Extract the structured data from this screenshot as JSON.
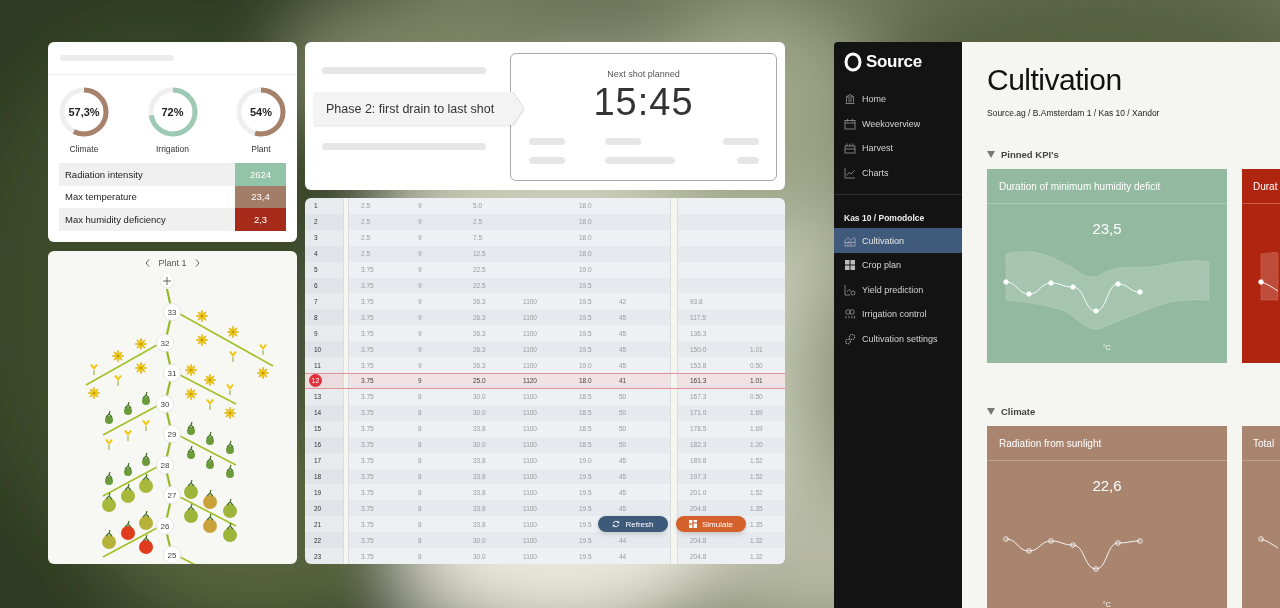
{
  "summary": {
    "donuts": [
      {
        "value": "57,3%",
        "label": "Climate",
        "level": 0.573,
        "color": "#a7816a"
      },
      {
        "value": "72%",
        "label": "Irrigation",
        "level": 0.72,
        "color": "#9dcab4"
      },
      {
        "value": "54%",
        "label": "Plant",
        "level": 0.54,
        "color": "#a7816a"
      }
    ],
    "kpis": [
      {
        "label": "Radiation intensity",
        "value": "2624",
        "color": "#93c3a9"
      },
      {
        "label": "Max temperature",
        "value": "23,4",
        "color": "#a47d69"
      },
      {
        "label": "Max humidity deficiency",
        "value": "2,3",
        "color": "#a52a1a"
      }
    ]
  },
  "plant": {
    "title": "Plant 1",
    "nodes": [
      "33",
      "32",
      "31",
      "30",
      "29",
      "28",
      "27",
      "26",
      "25"
    ]
  },
  "shot": {
    "phase": "Phase 2: first drain to last shot",
    "next_label": "Next shot planned",
    "time": "15:45"
  },
  "schedule": {
    "rows": [
      {
        "index": "1",
        "cells": [
          "2.5",
          "9",
          "5.0",
          null,
          "18.0",
          null,
          null,
          null
        ],
        "selected": false
      },
      {
        "index": "2",
        "cells": [
          "2.5",
          "9",
          "2.5",
          null,
          "18.0",
          null,
          null,
          null
        ],
        "selected": false
      },
      {
        "index": "3",
        "cells": [
          "2.5",
          "9",
          "7.5",
          null,
          "18.0",
          null,
          null,
          null
        ],
        "selected": false
      },
      {
        "index": "4",
        "cells": [
          "2.5",
          "9",
          "12.5",
          null,
          "18.0",
          null,
          null,
          null
        ],
        "selected": false
      },
      {
        "index": "5",
        "cells": [
          "3.75",
          "9",
          "22.5",
          null,
          "19.0",
          null,
          null,
          null
        ],
        "selected": false
      },
      {
        "index": "6",
        "cells": [
          "3.75",
          "9",
          "22.5",
          null,
          "19.5",
          null,
          null,
          null
        ],
        "selected": false
      },
      {
        "index": "7",
        "cells": [
          "3.75",
          "9",
          "26.3",
          "1100",
          "19.5",
          "42",
          "93.8",
          null
        ],
        "selected": false
      },
      {
        "index": "8",
        "cells": [
          "3.75",
          "9",
          "26.3",
          "1100",
          "19.5",
          "45",
          "117.5",
          null
        ],
        "selected": false
      },
      {
        "index": "9",
        "cells": [
          "3.75",
          "9",
          "26.3",
          "1100",
          "19.5",
          "45",
          "136.3",
          null
        ],
        "selected": false
      },
      {
        "index": "10",
        "cells": [
          "3.75",
          "9",
          "26.3",
          "1100",
          "19.5",
          "45",
          "150.0",
          "1.01"
        ],
        "selected": false
      },
      {
        "index": "11",
        "cells": [
          "3.75",
          "9",
          "26.3",
          "1100",
          "19.0",
          "45",
          "153.8",
          "0.50"
        ],
        "selected": false
      },
      {
        "index": "12",
        "cells": [
          "3.75",
          "9",
          "25.0",
          "1120",
          "18.0",
          "41",
          "161.3",
          "1.01"
        ],
        "selected": true
      },
      {
        "index": "13",
        "cells": [
          "3.75",
          "8",
          "30.0",
          "1100",
          "18.5",
          "50",
          "167.3",
          "0.50"
        ],
        "selected": false
      },
      {
        "index": "14",
        "cells": [
          "3.75",
          "8",
          "30.0",
          "1100",
          "18.5",
          "50",
          "171.0",
          "1.69"
        ],
        "selected": false
      },
      {
        "index": "15",
        "cells": [
          "3.75",
          "8",
          "33.8",
          "1100",
          "18.5",
          "50",
          "178.5",
          "1.69"
        ],
        "selected": false
      },
      {
        "index": "16",
        "cells": [
          "3.75",
          "8",
          "30.0",
          "1100",
          "18.5",
          "50",
          "182.3",
          "1.20"
        ],
        "selected": false
      },
      {
        "index": "17",
        "cells": [
          "3.75",
          "8",
          "33.8",
          "1100",
          "19.0",
          "45",
          "189.8",
          "1.52"
        ],
        "selected": false
      },
      {
        "index": "18",
        "cells": [
          "3.75",
          "8",
          "33.8",
          "1100",
          "19.5",
          "45",
          "197.3",
          "1.52"
        ],
        "selected": false
      },
      {
        "index": "19",
        "cells": [
          "3.75",
          "8",
          "33.8",
          "1100",
          "19.5",
          "45",
          "201.0",
          "1.52"
        ],
        "selected": false
      },
      {
        "index": "20",
        "cells": [
          "3.75",
          "8",
          "33.8",
          "1100",
          "19.5",
          "45",
          "204.8",
          "1.35"
        ],
        "selected": false
      },
      {
        "index": "21",
        "cells": [
          "3.75",
          "8",
          "33.8",
          "1100",
          "19.5",
          null,
          null,
          "1.35"
        ],
        "selected": false
      },
      {
        "index": "22",
        "cells": [
          "3.75",
          "8",
          "30.0",
          "1100",
          "19.5",
          "44",
          "204.8",
          "1.32"
        ],
        "selected": false
      },
      {
        "index": "23",
        "cells": [
          "3.75",
          "8",
          "30.0",
          "1100",
          "19.5",
          "44",
          "204.8",
          "1.32"
        ],
        "selected": false
      }
    ],
    "actions": [
      {
        "label": "Refresh",
        "kind": "refresh"
      },
      {
        "label": "Simulate",
        "kind": "simulate"
      }
    ]
  },
  "app": {
    "logo": "Source",
    "nav": [
      {
        "label": "Home",
        "selected": false
      },
      {
        "label": "Weekoverview",
        "selected": false
      },
      {
        "label": "Harvest",
        "selected": false
      },
      {
        "label": "Charts",
        "selected": false
      }
    ],
    "group_title": "Kas 10 / Pomodolce",
    "group_nav": [
      {
        "label": "Cultivation",
        "selected": true
      },
      {
        "label": "Crop plan",
        "selected": false
      },
      {
        "label": "Yield prediction",
        "selected": false
      },
      {
        "label": "Irrigation control",
        "selected": false
      },
      {
        "label": "Cultivation settings",
        "selected": false
      }
    ],
    "title": "Cultivation",
    "breadcrumb": "Source.ag / B.Amsterdam 1 / Kas 10 / Xandor",
    "sections": [
      {
        "title": "Pinned KPI's",
        "expanded": true,
        "cards": [
          {
            "title": "Duration of minimum humidity deficit",
            "value": "23,5",
            "unit": "°C",
            "color": "#93b9a0"
          },
          {
            "title": "Durat",
            "color": "#b02510"
          }
        ]
      },
      {
        "title": "Climate",
        "expanded": true,
        "cards": [
          {
            "title": "Radiation from sunlight",
            "value": "22,6",
            "unit": "°C",
            "color": "#a98570"
          },
          {
            "title": "Total",
            "color": "#a98570"
          }
        ]
      }
    ]
  }
}
